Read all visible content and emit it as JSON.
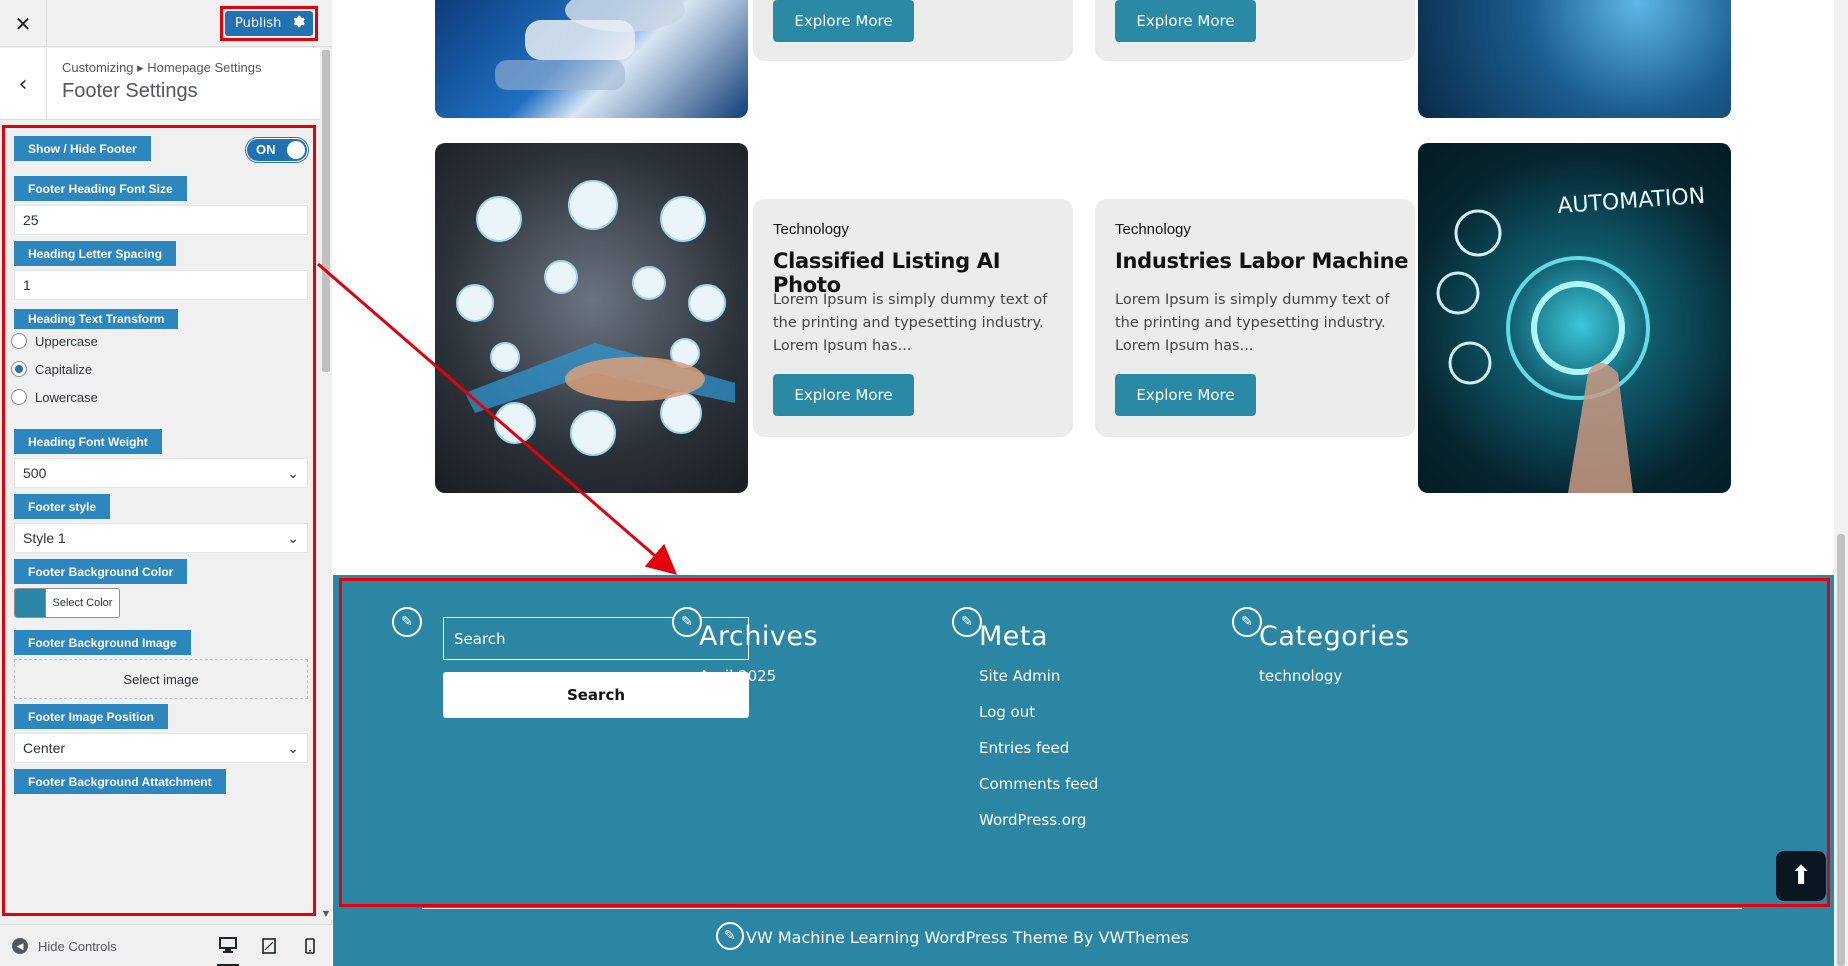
{
  "header": {
    "close_label": "✕",
    "publish_label": "Publish",
    "publish_gear": "gear-icon"
  },
  "section": {
    "breadcrumb": "Customizing ▸ Homepage Settings",
    "title": "Footer Settings"
  },
  "controls": {
    "show_hide_label": "Show / Hide Footer",
    "toggle_value": "ON",
    "heading_font_size_label": "Footer Heading Font Size",
    "heading_font_size_value": "25",
    "letter_spacing_label": "Heading Letter Spacing",
    "letter_spacing_value": "1",
    "text_transform_label": "Heading Text Transform",
    "text_transform_options": [
      "Uppercase",
      "Capitalize",
      "Lowercase"
    ],
    "text_transform_selected": "Capitalize",
    "font_weight_label": "Heading Font Weight",
    "font_weight_value": "500",
    "footer_style_label": "Footer style",
    "footer_style_value": "Style 1",
    "bg_color_label": "Footer Background Color",
    "bg_color_button": "Select Color",
    "bg_color_value": "#2d86a5",
    "bg_image_label": "Footer Background Image",
    "bg_image_button": "Select image",
    "image_position_label": "Footer Image Position",
    "image_position_value": "Center",
    "bg_attachment_label": "Footer Background Attatchment"
  },
  "panel_footer": {
    "hide_controls": "Hide Controls",
    "devices": [
      "desktop-icon",
      "tablet-icon",
      "mobile-icon"
    ]
  },
  "cards": {
    "top_buttons": [
      "Explore More",
      "Explore More"
    ],
    "items": [
      {
        "category": "Technology",
        "title": "Classified Listing AI Photo",
        "text": "Lorem Ipsum is simply dummy text of the printing and typesetting industry. Lorem Ipsum has...",
        "button": "Explore More"
      },
      {
        "category": "Technology",
        "title": "Industries Labor Machine",
        "text": "Lorem Ipsum is simply dummy text of the printing and typesetting industry. Lorem Ipsum has...",
        "button": "Explore More"
      }
    ],
    "automation_text": "AUTOMATION"
  },
  "footer": {
    "search_placeholder": "Search",
    "search_button": "Search",
    "archives_title": "Archives",
    "archives_links": [
      "April 2025"
    ],
    "meta_title": "Meta",
    "meta_links": [
      "Site Admin",
      "Log out",
      "Entries feed",
      "Comments feed",
      "WordPress.org"
    ],
    "categories_title": "Categories",
    "categories_links": [
      "technology"
    ],
    "copyright": "VW Machine Learning WordPress Theme By VWThemes",
    "background": "#2b86a3"
  },
  "colors": {
    "accent": "#2271b1",
    "label_bg": "#2d86be",
    "highlight": "#e3000b",
    "button_teal": "#2a8aa5"
  }
}
